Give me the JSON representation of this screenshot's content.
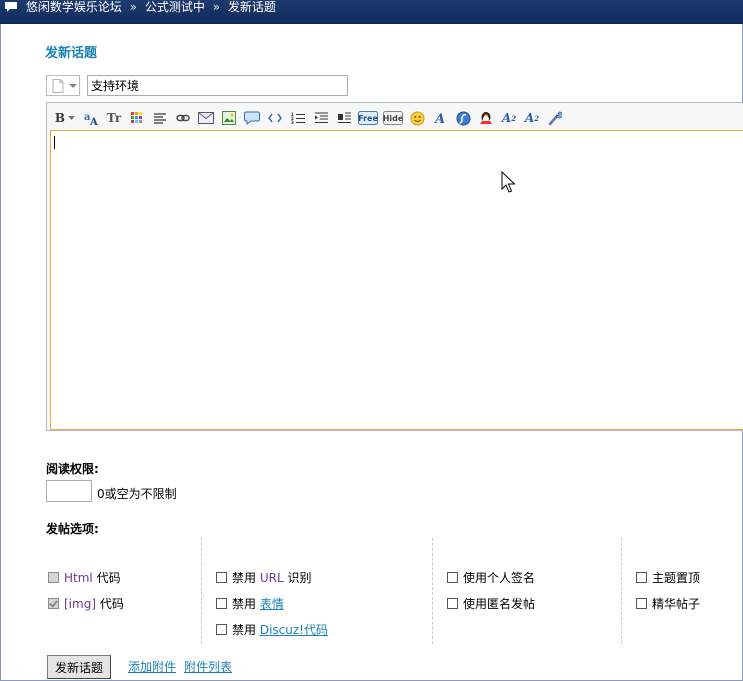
{
  "breadcrumb": {
    "items": [
      "悠闲数学娱乐论坛",
      "公式测试中",
      "发新话题"
    ],
    "separator": "»"
  },
  "page": {
    "title": "发新话题"
  },
  "subject": {
    "value": "支持环境"
  },
  "toolbar": {
    "icons": [
      "bold-icon",
      "font-color-icon",
      "font-size-icon",
      "color-grid-icon",
      "align-icon",
      "link-icon",
      "email-icon",
      "image-icon",
      "quote-icon",
      "code-icon",
      "ordered-list-icon",
      "indent-icon",
      "align-right-icon",
      "free-icon",
      "hide-icon",
      "smiley-icon",
      "font-icon",
      "flash-icon",
      "qq-icon",
      "superscript-icon",
      "subscript-icon",
      "tools-icon"
    ],
    "bold_label": "B",
    "tt_label": "Tr",
    "free_label": "Free",
    "hide_label": "Hide",
    "sup_label": "A",
    "sub_label": "A"
  },
  "read_permission": {
    "label": "阅读权限:",
    "value": "",
    "hint": "0或空为不限制"
  },
  "post_options": {
    "label": "发帖选项:",
    "html_code": {
      "keyword": "Html",
      "suffix": "代码",
      "checked": false,
      "disabled": true
    },
    "img_code": {
      "keyword": "[img]",
      "suffix": "代码",
      "checked": true,
      "disabled": true
    },
    "disable_url": {
      "prefix": "禁用",
      "keyword": "URL",
      "suffix": "识别",
      "checked": false
    },
    "disable_smilies": {
      "prefix": "禁用",
      "link": "表情",
      "checked": false
    },
    "disable_discuz": {
      "prefix": "禁用",
      "link": "Discuz!代码",
      "checked": false
    },
    "use_signature": {
      "label": "使用个人签名",
      "checked": false
    },
    "anonymous": {
      "label": "使用匿名发帖",
      "checked": false
    },
    "sticky": {
      "label": "主题置顶",
      "checked": false
    },
    "digest": {
      "label": "精华帖子",
      "checked": false
    }
  },
  "actions": {
    "submit_label": "发新话题",
    "add_attachment": "添加附件",
    "attachment_list": "附件列表"
  },
  "colors": {
    "topbar": "#0f2c5c",
    "title": "#1b82b8",
    "editor_focus": "#f2a54a",
    "keyword": "#6b3b8a"
  }
}
